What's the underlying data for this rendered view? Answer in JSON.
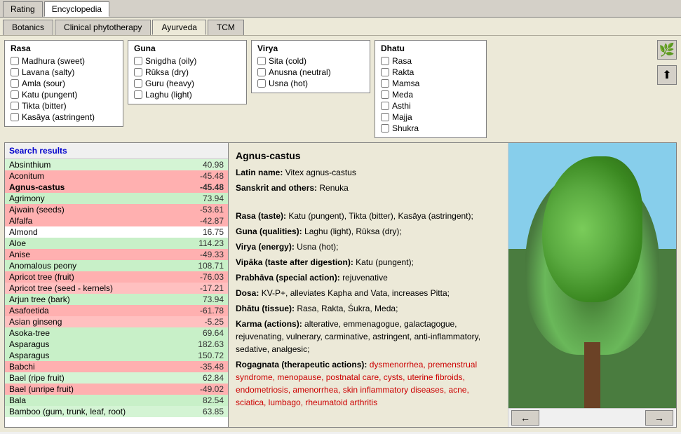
{
  "topTabs": [
    {
      "label": "Rating",
      "active": false
    },
    {
      "label": "Encyclopedia",
      "active": true
    }
  ],
  "secondTabs": [
    {
      "label": "Botanics",
      "active": false
    },
    {
      "label": "Clinical phytotherapy",
      "active": false
    },
    {
      "label": "Ayurveda",
      "active": true
    },
    {
      "label": "TCM",
      "active": false
    }
  ],
  "filters": {
    "rasa": {
      "title": "Rasa",
      "items": [
        {
          "label": "Madhura (sweet)",
          "checked": false
        },
        {
          "label": "Lavana (salty)",
          "checked": false
        },
        {
          "label": "Amla (sour)",
          "checked": false
        },
        {
          "label": "Katu (pungent)",
          "checked": false
        },
        {
          "label": "Tikta (bitter)",
          "checked": false
        },
        {
          "label": "Kasāya (astringent)",
          "checked": false
        }
      ]
    },
    "guna": {
      "title": "Guna",
      "items": [
        {
          "label": "Snigdha (oily)",
          "checked": false
        },
        {
          "label": "Rūksa (dry)",
          "checked": false
        },
        {
          "label": "Guru (heavy)",
          "checked": false
        },
        {
          "label": "Laghu (light)",
          "checked": false
        }
      ]
    },
    "virya": {
      "title": "Virya",
      "items": [
        {
          "label": "Sita (cold)",
          "checked": false
        },
        {
          "label": "Anusna (neutral)",
          "checked": false
        },
        {
          "label": "Usna (hot)",
          "checked": false
        }
      ]
    },
    "dhatu": {
      "title": "Dhatu",
      "items": [
        {
          "label": "Rasa",
          "checked": false
        },
        {
          "label": "Rakta",
          "checked": false
        },
        {
          "label": "Mamsa",
          "checked": false
        },
        {
          "label": "Meda",
          "checked": false
        },
        {
          "label": "Asthi",
          "checked": false
        },
        {
          "label": "Majja",
          "checked": false
        },
        {
          "label": "Shukra",
          "checked": false
        }
      ]
    }
  },
  "searchPane": {
    "title": "Search results",
    "rows": [
      {
        "name": "Absinthium",
        "score": "40.98",
        "bg": "bg-lightgreen"
      },
      {
        "name": "Aconitum",
        "score": "-45.48",
        "bg": "bg-red"
      },
      {
        "name": "Agnus-castus",
        "score": "-45.48",
        "bg": "bg-red",
        "selected": true
      },
      {
        "name": "Agrimony",
        "score": "73.94",
        "bg": "bg-green"
      },
      {
        "name": "Ajwain (seeds)",
        "score": "-53.61",
        "bg": "bg-red"
      },
      {
        "name": "Alfalfa",
        "score": "-42.87",
        "bg": "bg-red"
      },
      {
        "name": "Almond",
        "score": "16.75",
        "bg": "bg-white"
      },
      {
        "name": "Aloe",
        "score": "114.23",
        "bg": "bg-green"
      },
      {
        "name": "Anise",
        "score": "-49.33",
        "bg": "bg-red"
      },
      {
        "name": "Anomalous peony",
        "score": "108.71",
        "bg": "bg-green"
      },
      {
        "name": "Apricot tree (fruit)",
        "score": "-76.03",
        "bg": "bg-red"
      },
      {
        "name": "Apricot tree (seed - kernels)",
        "score": "-17.21",
        "bg": "bg-pink"
      },
      {
        "name": "Arjun tree (bark)",
        "score": "73.94",
        "bg": "bg-green"
      },
      {
        "name": "Asafoetida",
        "score": "-61.78",
        "bg": "bg-red"
      },
      {
        "name": "Asian ginseng",
        "score": "-5.25",
        "bg": "bg-pink"
      },
      {
        "name": "Asoka-tree",
        "score": "69.64",
        "bg": "bg-green"
      },
      {
        "name": "Asparagus",
        "score": "182.63",
        "bg": "bg-green"
      },
      {
        "name": "Asparagus",
        "score": "150.72",
        "bg": "bg-green"
      },
      {
        "name": "Babchi",
        "score": "-35.48",
        "bg": "bg-red"
      },
      {
        "name": "Bael (ripe fruit)",
        "score": "62.84",
        "bg": "bg-lightgreen"
      },
      {
        "name": "Bael (unripe fruit)",
        "score": "-49.02",
        "bg": "bg-red"
      },
      {
        "name": "Bala",
        "score": "82.54",
        "bg": "bg-green"
      },
      {
        "name": "Bamboo (gum, trunk, leaf, root)",
        "score": "63.85",
        "bg": "bg-lightgreen"
      }
    ]
  },
  "detail": {
    "title": "Agnus-castus",
    "latinName": "Vitex agnus-castus",
    "sanskrit": "Renuka",
    "rasa": "Katu (pungent), Tikta (bitter), Kasāya (astringent);",
    "guna": "Laghu (light), Rūksa (dry);",
    "virya": "Usna (hot);",
    "vipaka": "Katu (pungent);",
    "prabhava": "rejuvenative",
    "dosa": "KV-P+, alleviates Kapha and Vata, increases Pitta;",
    "dhatu": "Rasa, Rakta, Śukra, Meda;",
    "karma": "alterative, emmenagogue, galactagogue, rejuvenating, vulnerary, carminative, astringent, anti-inflammatory, sedative, analgesic;",
    "rogagnata": "dysmenorrhea, premenstrual syndrome, menopause, postnatal care, cysts, uterine fibroids, endometriosis, amenorrhea, skin inflammatory diseases, acne, sciatica, lumbago, rheumatoid arthritis"
  },
  "icons": {
    "upload": "⬆",
    "left_arrow": "←",
    "right_arrow": "→",
    "herb_icon": "🌿"
  }
}
